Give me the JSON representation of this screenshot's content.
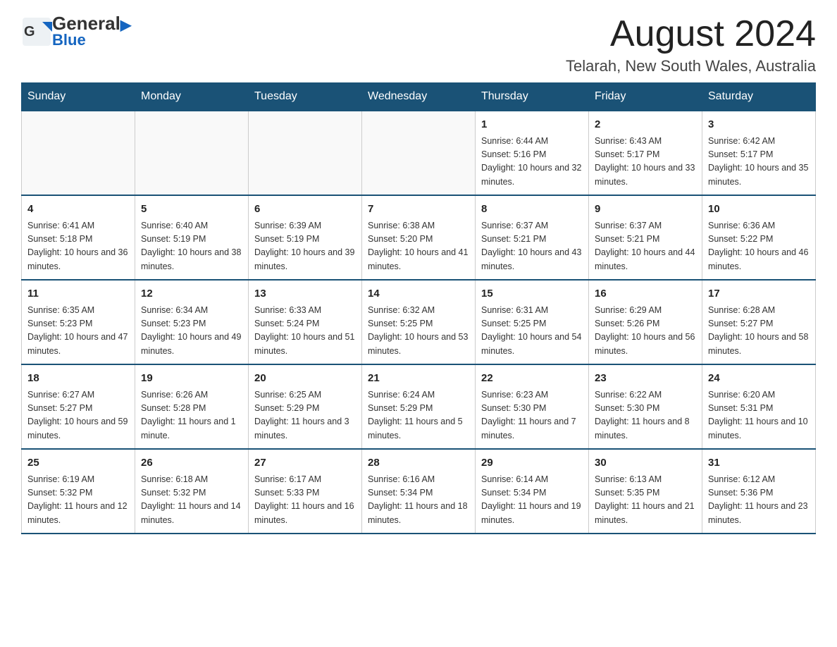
{
  "header": {
    "logo_general": "General",
    "logo_blue": "Blue",
    "main_title": "August 2024",
    "subtitle": "Telarah, New South Wales, Australia"
  },
  "calendar": {
    "days_of_week": [
      "Sunday",
      "Monday",
      "Tuesday",
      "Wednesday",
      "Thursday",
      "Friday",
      "Saturday"
    ],
    "weeks": [
      [
        {
          "day": "",
          "info": ""
        },
        {
          "day": "",
          "info": ""
        },
        {
          "day": "",
          "info": ""
        },
        {
          "day": "",
          "info": ""
        },
        {
          "day": "1",
          "info": "Sunrise: 6:44 AM\nSunset: 5:16 PM\nDaylight: 10 hours and 32 minutes."
        },
        {
          "day": "2",
          "info": "Sunrise: 6:43 AM\nSunset: 5:17 PM\nDaylight: 10 hours and 33 minutes."
        },
        {
          "day": "3",
          "info": "Sunrise: 6:42 AM\nSunset: 5:17 PM\nDaylight: 10 hours and 35 minutes."
        }
      ],
      [
        {
          "day": "4",
          "info": "Sunrise: 6:41 AM\nSunset: 5:18 PM\nDaylight: 10 hours and 36 minutes."
        },
        {
          "day": "5",
          "info": "Sunrise: 6:40 AM\nSunset: 5:19 PM\nDaylight: 10 hours and 38 minutes."
        },
        {
          "day": "6",
          "info": "Sunrise: 6:39 AM\nSunset: 5:19 PM\nDaylight: 10 hours and 39 minutes."
        },
        {
          "day": "7",
          "info": "Sunrise: 6:38 AM\nSunset: 5:20 PM\nDaylight: 10 hours and 41 minutes."
        },
        {
          "day": "8",
          "info": "Sunrise: 6:37 AM\nSunset: 5:21 PM\nDaylight: 10 hours and 43 minutes."
        },
        {
          "day": "9",
          "info": "Sunrise: 6:37 AM\nSunset: 5:21 PM\nDaylight: 10 hours and 44 minutes."
        },
        {
          "day": "10",
          "info": "Sunrise: 6:36 AM\nSunset: 5:22 PM\nDaylight: 10 hours and 46 minutes."
        }
      ],
      [
        {
          "day": "11",
          "info": "Sunrise: 6:35 AM\nSunset: 5:23 PM\nDaylight: 10 hours and 47 minutes."
        },
        {
          "day": "12",
          "info": "Sunrise: 6:34 AM\nSunset: 5:23 PM\nDaylight: 10 hours and 49 minutes."
        },
        {
          "day": "13",
          "info": "Sunrise: 6:33 AM\nSunset: 5:24 PM\nDaylight: 10 hours and 51 minutes."
        },
        {
          "day": "14",
          "info": "Sunrise: 6:32 AM\nSunset: 5:25 PM\nDaylight: 10 hours and 53 minutes."
        },
        {
          "day": "15",
          "info": "Sunrise: 6:31 AM\nSunset: 5:25 PM\nDaylight: 10 hours and 54 minutes."
        },
        {
          "day": "16",
          "info": "Sunrise: 6:29 AM\nSunset: 5:26 PM\nDaylight: 10 hours and 56 minutes."
        },
        {
          "day": "17",
          "info": "Sunrise: 6:28 AM\nSunset: 5:27 PM\nDaylight: 10 hours and 58 minutes."
        }
      ],
      [
        {
          "day": "18",
          "info": "Sunrise: 6:27 AM\nSunset: 5:27 PM\nDaylight: 10 hours and 59 minutes."
        },
        {
          "day": "19",
          "info": "Sunrise: 6:26 AM\nSunset: 5:28 PM\nDaylight: 11 hours and 1 minute."
        },
        {
          "day": "20",
          "info": "Sunrise: 6:25 AM\nSunset: 5:29 PM\nDaylight: 11 hours and 3 minutes."
        },
        {
          "day": "21",
          "info": "Sunrise: 6:24 AM\nSunset: 5:29 PM\nDaylight: 11 hours and 5 minutes."
        },
        {
          "day": "22",
          "info": "Sunrise: 6:23 AM\nSunset: 5:30 PM\nDaylight: 11 hours and 7 minutes."
        },
        {
          "day": "23",
          "info": "Sunrise: 6:22 AM\nSunset: 5:30 PM\nDaylight: 11 hours and 8 minutes."
        },
        {
          "day": "24",
          "info": "Sunrise: 6:20 AM\nSunset: 5:31 PM\nDaylight: 11 hours and 10 minutes."
        }
      ],
      [
        {
          "day": "25",
          "info": "Sunrise: 6:19 AM\nSunset: 5:32 PM\nDaylight: 11 hours and 12 minutes."
        },
        {
          "day": "26",
          "info": "Sunrise: 6:18 AM\nSunset: 5:32 PM\nDaylight: 11 hours and 14 minutes."
        },
        {
          "day": "27",
          "info": "Sunrise: 6:17 AM\nSunset: 5:33 PM\nDaylight: 11 hours and 16 minutes."
        },
        {
          "day": "28",
          "info": "Sunrise: 6:16 AM\nSunset: 5:34 PM\nDaylight: 11 hours and 18 minutes."
        },
        {
          "day": "29",
          "info": "Sunrise: 6:14 AM\nSunset: 5:34 PM\nDaylight: 11 hours and 19 minutes."
        },
        {
          "day": "30",
          "info": "Sunrise: 6:13 AM\nSunset: 5:35 PM\nDaylight: 11 hours and 21 minutes."
        },
        {
          "day": "31",
          "info": "Sunrise: 6:12 AM\nSunset: 5:36 PM\nDaylight: 11 hours and 23 minutes."
        }
      ]
    ]
  }
}
